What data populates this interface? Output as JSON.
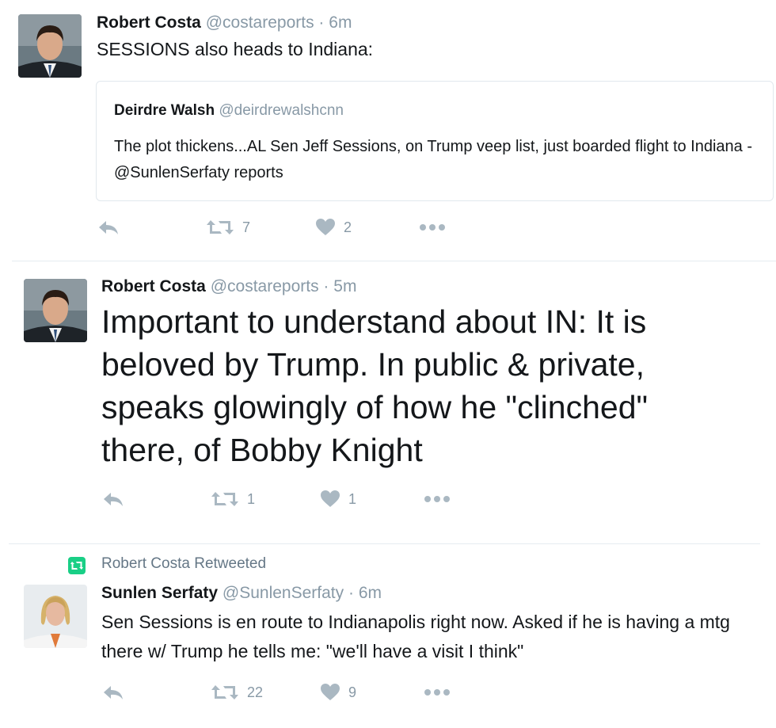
{
  "tweets": [
    {
      "author": "Robert Costa",
      "handle": "@costareports",
      "separator": "·",
      "time": "6m",
      "text": "SESSIONS also heads to Indiana:",
      "quote": {
        "author": "Deirdre Walsh",
        "handle": "@deirdrewalshcnn",
        "text": "The plot thickens...AL Sen Jeff Sessions, on Trump veep list, just boarded flight to Indiana - @SunlenSerfaty reports"
      },
      "retweets": "7",
      "likes": "2"
    },
    {
      "author": "Robert Costa",
      "handle": "@costareports",
      "separator": "·",
      "time": "5m",
      "text": "Important to understand about IN: It is beloved by Trump. In public & private, speaks glowingly of how he \"clinched\" there, of Bobby Knight",
      "retweets": "1",
      "likes": "1"
    },
    {
      "retweeted_by": "Robert Costa Retweeted",
      "author": "Sunlen Serfaty",
      "handle": "@SunlenSerfaty",
      "separator": "·",
      "time": "6m",
      "text": "Sen Sessions is en route to Indianapolis right now. Asked if he is having a mtg there w/ Trump he tells me: \"we'll have a visit I think\"",
      "retweets": "22",
      "likes": "9"
    }
  ],
  "icons": {
    "reply": "reply-icon",
    "retweet": "retweet-icon",
    "like": "heart-icon",
    "more": "more-icon"
  },
  "colors": {
    "icon_gray": "#aab8c2",
    "text_gray": "#8899a6",
    "retweet_badge": "#19cf86"
  }
}
